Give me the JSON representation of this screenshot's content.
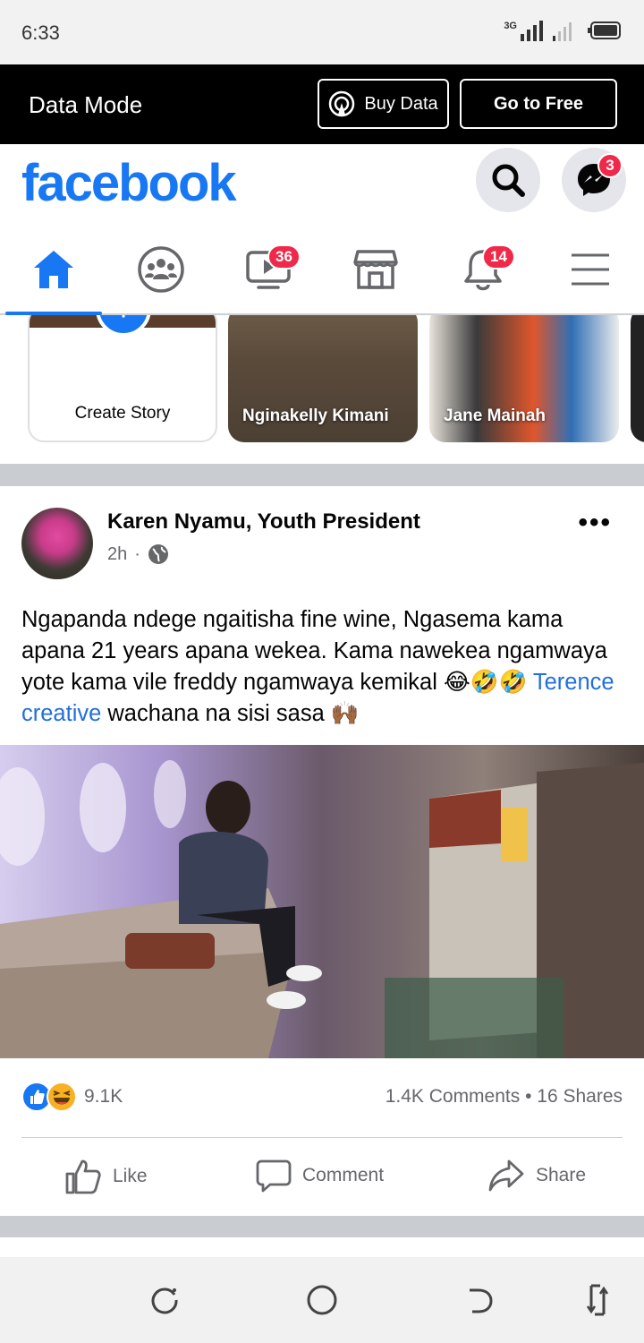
{
  "status_bar": {
    "time": "6:33",
    "network": "3G"
  },
  "data_bar": {
    "title": "Data Mode",
    "buy_label": "Buy Data",
    "free_label": "Go to Free"
  },
  "header": {
    "logo": "facebook",
    "messenger_badge": "3"
  },
  "tabs": [
    {
      "name": "home",
      "icon": "home-icon",
      "badge": ""
    },
    {
      "name": "groups",
      "icon": "groups-icon",
      "badge": ""
    },
    {
      "name": "watch",
      "icon": "video-icon",
      "badge": "36"
    },
    {
      "name": "marketplace",
      "icon": "store-icon",
      "badge": ""
    },
    {
      "name": "notifications",
      "icon": "bell-icon",
      "badge": "14"
    },
    {
      "name": "menu",
      "icon": "menu-icon",
      "badge": ""
    }
  ],
  "stories": {
    "create_label": "Create Story",
    "items": [
      {
        "name": "Nginakelly Kimani"
      },
      {
        "name": "Jane Mainah"
      }
    ]
  },
  "post": {
    "author": "Karen Nyamu, Youth President",
    "time": "2h",
    "text_before": "Ngapanda ndege ngaitisha fine wine, Ngasema kama apana 21 years apana wekea. Kama nawekea ngamwaya yote kama vile freddy ngamwaya kemikal ",
    "emojis": "😂🤣🤣",
    "mention": "Terence creative",
    "text_after": " wachana na sisi sasa 🙌🏾",
    "reaction_count": "9.1K",
    "comments_shares": "1.4K Comments • 16 Shares",
    "actions": {
      "like": "Like",
      "comment": "Comment",
      "share": "Share"
    }
  },
  "colors": {
    "brand": "#1877f2",
    "badge": "#f02849",
    "mention": "#216fdb"
  }
}
